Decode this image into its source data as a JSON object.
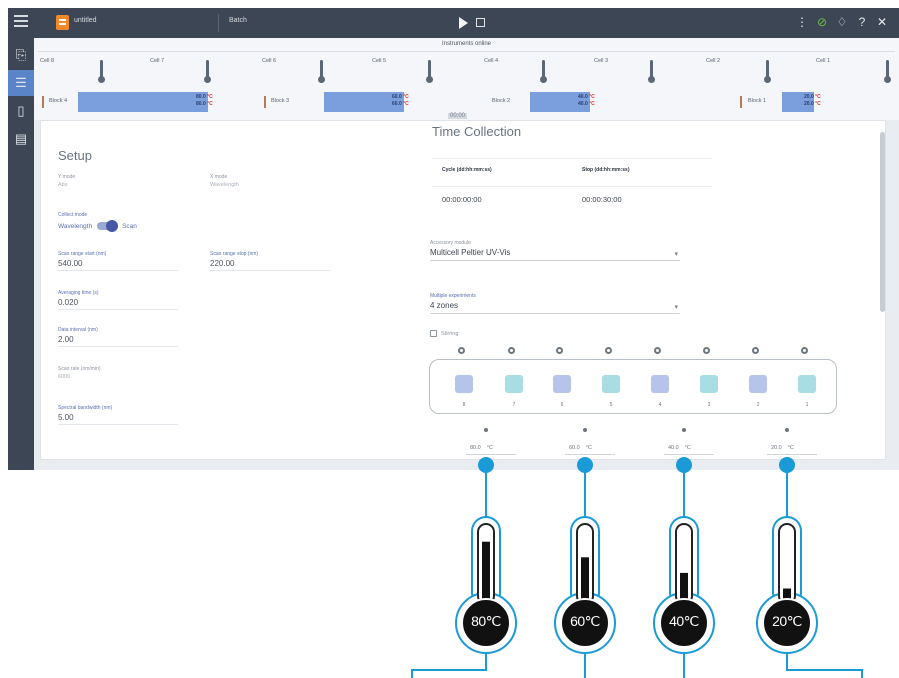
{
  "app": {
    "file_name": "untitled",
    "batch_label": "Batch",
    "instruments_title": "Instruments online",
    "timer": "00:00"
  },
  "instrument_groups": [
    {
      "cells": [
        "Cell 8",
        "Cell 7"
      ],
      "block": "Block 4",
      "temps": [
        "80.0",
        "80.0"
      ]
    },
    {
      "cells": [
        "Cell 6",
        "Cell 5"
      ],
      "block": "Block 3",
      "temps": [
        "60.0",
        "60.0"
      ]
    },
    {
      "cells": [
        "Cell 4",
        "Cell 3"
      ],
      "block": "Block 2",
      "temps": [
        "40.0",
        "40.0"
      ]
    },
    {
      "cells": [
        "Cell 2",
        "Cell 1"
      ],
      "block": "Block 1",
      "temps": [
        "20.0",
        "20.0"
      ]
    }
  ],
  "block_unit": "°C",
  "setup": {
    "title": "Setup",
    "y_label": "Y mode",
    "y_value": "Abs",
    "x_label": "X mode",
    "x_value": "Wavelength",
    "collect_label": "Collect mode",
    "mode_left": "Wavelength",
    "mode_right": "Scan",
    "scan_start_label": "Scan range start (nm)",
    "scan_start": "540.00",
    "scan_stop_label": "Scan range stop (nm)",
    "scan_stop": "220.00",
    "averaging_label": "Averaging time (s)",
    "averaging": "0.020",
    "data_interval_label": "Data interval (nm)",
    "data_interval": "2.00",
    "scan_rate_label": "Scan rate (nm/min)",
    "scan_rate": "6000",
    "sbw_label": "Spectral bandwidth (nm)",
    "sbw": "5.00"
  },
  "time_collection": {
    "title": "Time Collection",
    "cycle_header": "Cycle (dd:hh:mm:ss)",
    "stop_header": "Stop (dd:hh:mm:ss)",
    "cycle_value": "00:00:00:00",
    "stop_value": "00:00:30:00",
    "accessory_label": "Accessory module",
    "accessory_value": "Multicell Peltier UV-Vis",
    "multiple_label": "Multiple experiments",
    "multiple_value": "4 zones",
    "stirring_label": "Stirring"
  },
  "cuvettes": [
    "8",
    "7",
    "6",
    "5",
    "4",
    "3",
    "2",
    "1"
  ],
  "zone_temps": [
    "80.0",
    "60.0",
    "40.0",
    "20.0"
  ],
  "temp_unit": "°C",
  "callouts": [
    "80℃",
    "60℃",
    "40℃",
    "20℃"
  ],
  "callout_fill": [
    0.85,
    0.65,
    0.45,
    0.25
  ],
  "colors": {
    "topbar": "#3d4654",
    "accent": "#5a84c8",
    "callout_blue": "#1a9ad6",
    "block_bar": "#7a9fdc",
    "cuvette_blue": "#b6c4ea",
    "cuvette_teal": "#a8dde4"
  }
}
